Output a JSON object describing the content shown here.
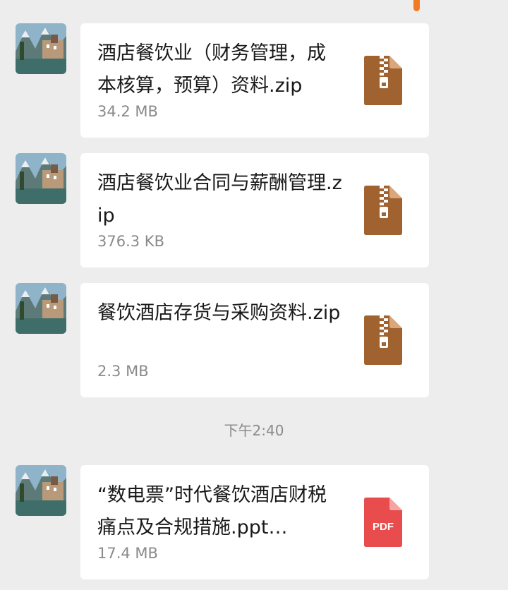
{
  "messages": [
    {
      "name": "酒店餐饮业（财务管理，成本核算，预算）资料.zip",
      "size": "34.2 MB",
      "icon": "zip-file-icon"
    },
    {
      "name": "酒店餐饮业合同与薪酬管理.zip",
      "size": "376.3 KB",
      "icon": "zip-file-icon"
    },
    {
      "name": "餐饮酒店存货与采购资料.zip",
      "size": "2.3 MB",
      "icon": "zip-file-icon"
    },
    {
      "name": "“数电票”时代餐饮酒店财税痛点及合规措施.ppt…",
      "size": "17.4 MB",
      "icon": "pdf-file-icon",
      "icon_label": "PDF"
    }
  ],
  "time_separator": "下午2:40",
  "colors": {
    "zip": "#a0622f",
    "pdf": "#e84c4c",
    "accent": "#f27a22"
  }
}
